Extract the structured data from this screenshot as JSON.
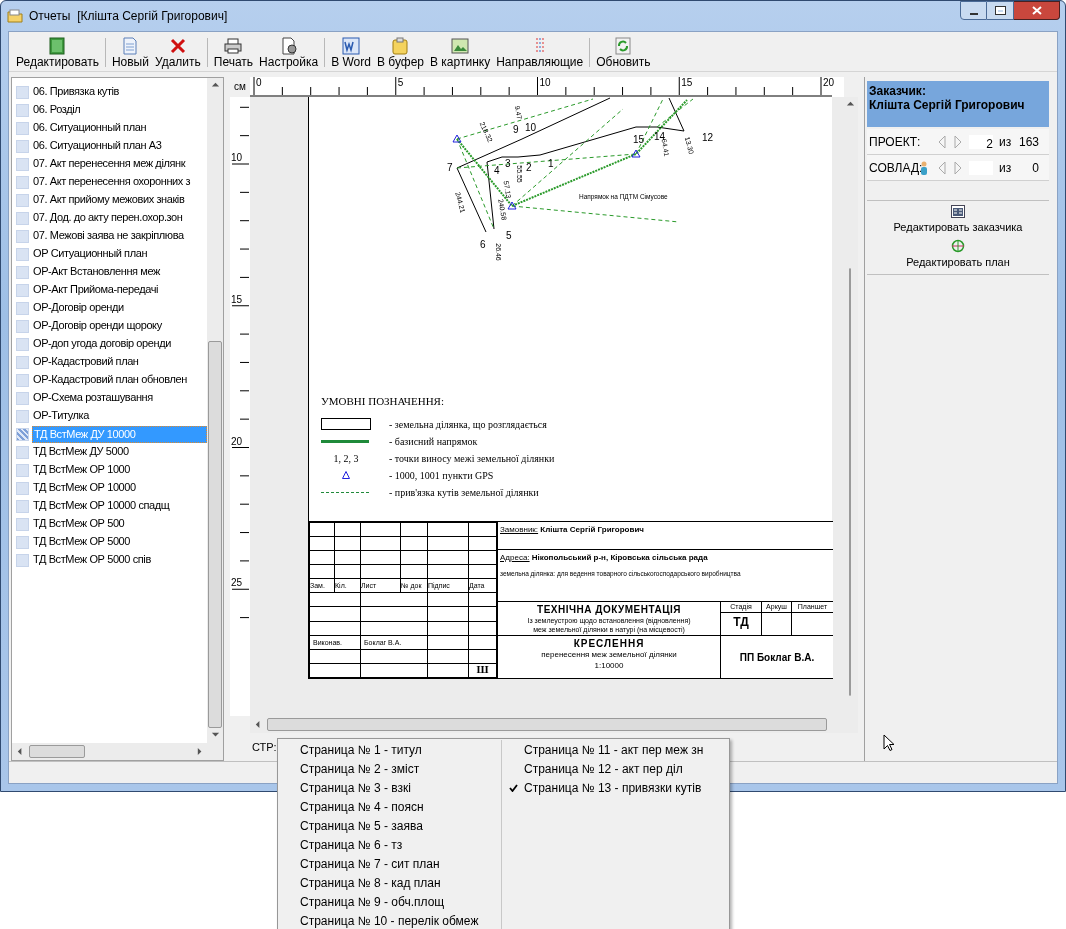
{
  "window": {
    "title": "Отчеты  [Клішта Сергій Григорович]"
  },
  "toolbar": {
    "groups": [
      [
        {
          "label": "Редактировать"
        }
      ],
      [
        {
          "label": "Новый"
        },
        {
          "label": "Удалить"
        }
      ],
      [
        {
          "label": "Печать"
        },
        {
          "label": "Настройка"
        }
      ],
      [
        {
          "label": "В Word"
        },
        {
          "label": "В буфер"
        },
        {
          "label": "В картинку"
        },
        {
          "label": "Направляющие"
        }
      ],
      [
        {
          "label": "Обновить"
        }
      ]
    ]
  },
  "report_list": {
    "items": [
      {
        "label": "06. Привязка кутів",
        "selected": false
      },
      {
        "label": "06. Розділ",
        "selected": false
      },
      {
        "label": "06. Ситуационный план",
        "selected": false
      },
      {
        "label": "06. Ситуационный план А3",
        "selected": false
      },
      {
        "label": "07. Акт перенесення меж ділянк",
        "selected": false
      },
      {
        "label": "07. Акт перенесення охоронних з",
        "selected": false
      },
      {
        "label": "07. Акт прийому межових знаків",
        "selected": false
      },
      {
        "label": "07. Дод. до акту перен.охор.зон",
        "selected": false
      },
      {
        "label": "07. Межові  заява не закріплюва",
        "selected": false
      },
      {
        "label": "ОР Ситуационный план",
        "selected": false
      },
      {
        "label": "ОР-Акт Встановлення меж",
        "selected": false
      },
      {
        "label": "ОР-Акт Прийома-передачі",
        "selected": false
      },
      {
        "label": "ОР-Договір оренди",
        "selected": false
      },
      {
        "label": "ОР-Договір оренди щороку",
        "selected": false
      },
      {
        "label": "ОР-доп угода договір оренди",
        "selected": false
      },
      {
        "label": "ОР-Кадастровий план",
        "selected": false
      },
      {
        "label": "ОР-Кадастровий план обновлен",
        "selected": false
      },
      {
        "label": "ОР-Схема розташування",
        "selected": false
      },
      {
        "label": "ОР-Титулка",
        "selected": false
      },
      {
        "label": "ТД ВстМеж ДУ 10000",
        "selected": true
      },
      {
        "label": "ТД ВстМеж ДУ 5000",
        "selected": false
      },
      {
        "label": "ТД ВстМеж ОР 1000",
        "selected": false
      },
      {
        "label": "ТД ВстМеж ОР 10000",
        "selected": false
      },
      {
        "label": "ТД ВстМеж ОР 10000 спадщ",
        "selected": false
      },
      {
        "label": "ТД ВстМеж ОР 500",
        "selected": false
      },
      {
        "label": "ТД ВстМеж ОР 5000",
        "selected": false
      },
      {
        "label": "ТД ВстМеж ОР 5000 спів",
        "selected": false
      }
    ]
  },
  "preview": {
    "unit": "см",
    "top_ruler": [
      "0",
      "5",
      "10",
      "15",
      "20"
    ],
    "side_ruler": [
      "10",
      "15",
      "20",
      "25"
    ],
    "drawing": {
      "points": [
        "9",
        "10",
        "7",
        "3",
        "2",
        "1",
        "4",
        "5",
        "6",
        "15",
        "14",
        "12"
      ],
      "distances": [
        "244.21",
        "240.58",
        "57.13",
        "55.55",
        "26.46",
        "13.30",
        "64.41",
        "218.32",
        "9.47"
      ],
      "direction_label": "Напрямок на ПДТМ Сімусове"
    },
    "legend": {
      "title": "УМОВНІ ПОЗНАЧЕННЯ:",
      "items": [
        {
          "kind": "outline",
          "text": "- земельна ділянка, що розглядається"
        },
        {
          "kind": "line",
          "text": "- базисний напрямок"
        },
        {
          "kind": "numbers",
          "symbol": "1, 2, 3",
          "text": "- точки виносу межі земельної ділянки"
        },
        {
          "kind": "triangle",
          "text": "- 1000, 1001 пункти GPS"
        },
        {
          "kind": "dashed",
          "text": "- прив'язка кутів земельної ділянки"
        }
      ]
    },
    "title_block": {
      "headers": [
        "Зам.",
        "Кіл.",
        "Лист",
        "№ док",
        "Підпис",
        "Дата"
      ],
      "executor_label": "Виконав.",
      "executor": "Боклаг В.А.",
      "sheet_mark": "Ш",
      "customer_label": "Замовник:",
      "customer": "Клішта Сергій Григорович",
      "address_label": "Адреса:",
      "address": "Нікопольський р-н, Кіровська сільська рада",
      "purpose": "земельна ділянка: для ведення товарного сільськогосподарського виробництва",
      "doc_title": "ТЕХНІЧНА ДОКУМЕНТАЦІЯ",
      "doc_subtitle": [
        "Із землеустрою щодо встановлення (відновлення)",
        "меж земельної ділянки в натурі (на місцевості)"
      ],
      "stage_headers": [
        "Стадія",
        "Аркуш",
        "Планшет"
      ],
      "stage": "ТД",
      "drawing_title": "КРЕСЛЕННЯ",
      "drawing_subtitle": "перенесення меж земельної ділянки",
      "scale": "1:10000",
      "company": "ПП Боклаг В.А."
    },
    "page_label": "СТР:"
  },
  "customer_panel": {
    "label": "Заказчик:",
    "name": "Клішта Сергій Григорович",
    "project": {
      "label": "ПРОЕКТ:",
      "current": "2",
      "of": "из",
      "total": "163"
    },
    "coowner": {
      "label": "СОВЛАД:",
      "of": "из",
      "total": "0"
    },
    "actions": [
      "Редактировать заказчика",
      "Редактировать план"
    ]
  },
  "page_menu": {
    "columns": [
      [
        {
          "label": "Страница № 1 - титул",
          "checked": false
        },
        {
          "label": "Страница № 2 - зміст",
          "checked": false
        },
        {
          "label": "Страница № 3 - взкі",
          "checked": false
        },
        {
          "label": "Страница № 4 - поясн",
          "checked": false
        },
        {
          "label": "Страница № 5 - заява",
          "checked": false
        },
        {
          "label": "Страница № 6 - тз",
          "checked": false
        },
        {
          "label": "Страница № 7 - сит план",
          "checked": false
        },
        {
          "label": "Страница № 8 - кад план",
          "checked": false
        },
        {
          "label": "Страница № 9 - обч.площ",
          "checked": false
        },
        {
          "label": "Страница № 10 - перелік обмеж",
          "checked": false
        }
      ],
      [
        {
          "label": "Страница № 11 - акт пер меж зн",
          "checked": false
        },
        {
          "label": "Страница № 12 - акт пер діл",
          "checked": false
        },
        {
          "label": "Страница № 13 - привязки кутів",
          "checked": true
        }
      ]
    ]
  }
}
